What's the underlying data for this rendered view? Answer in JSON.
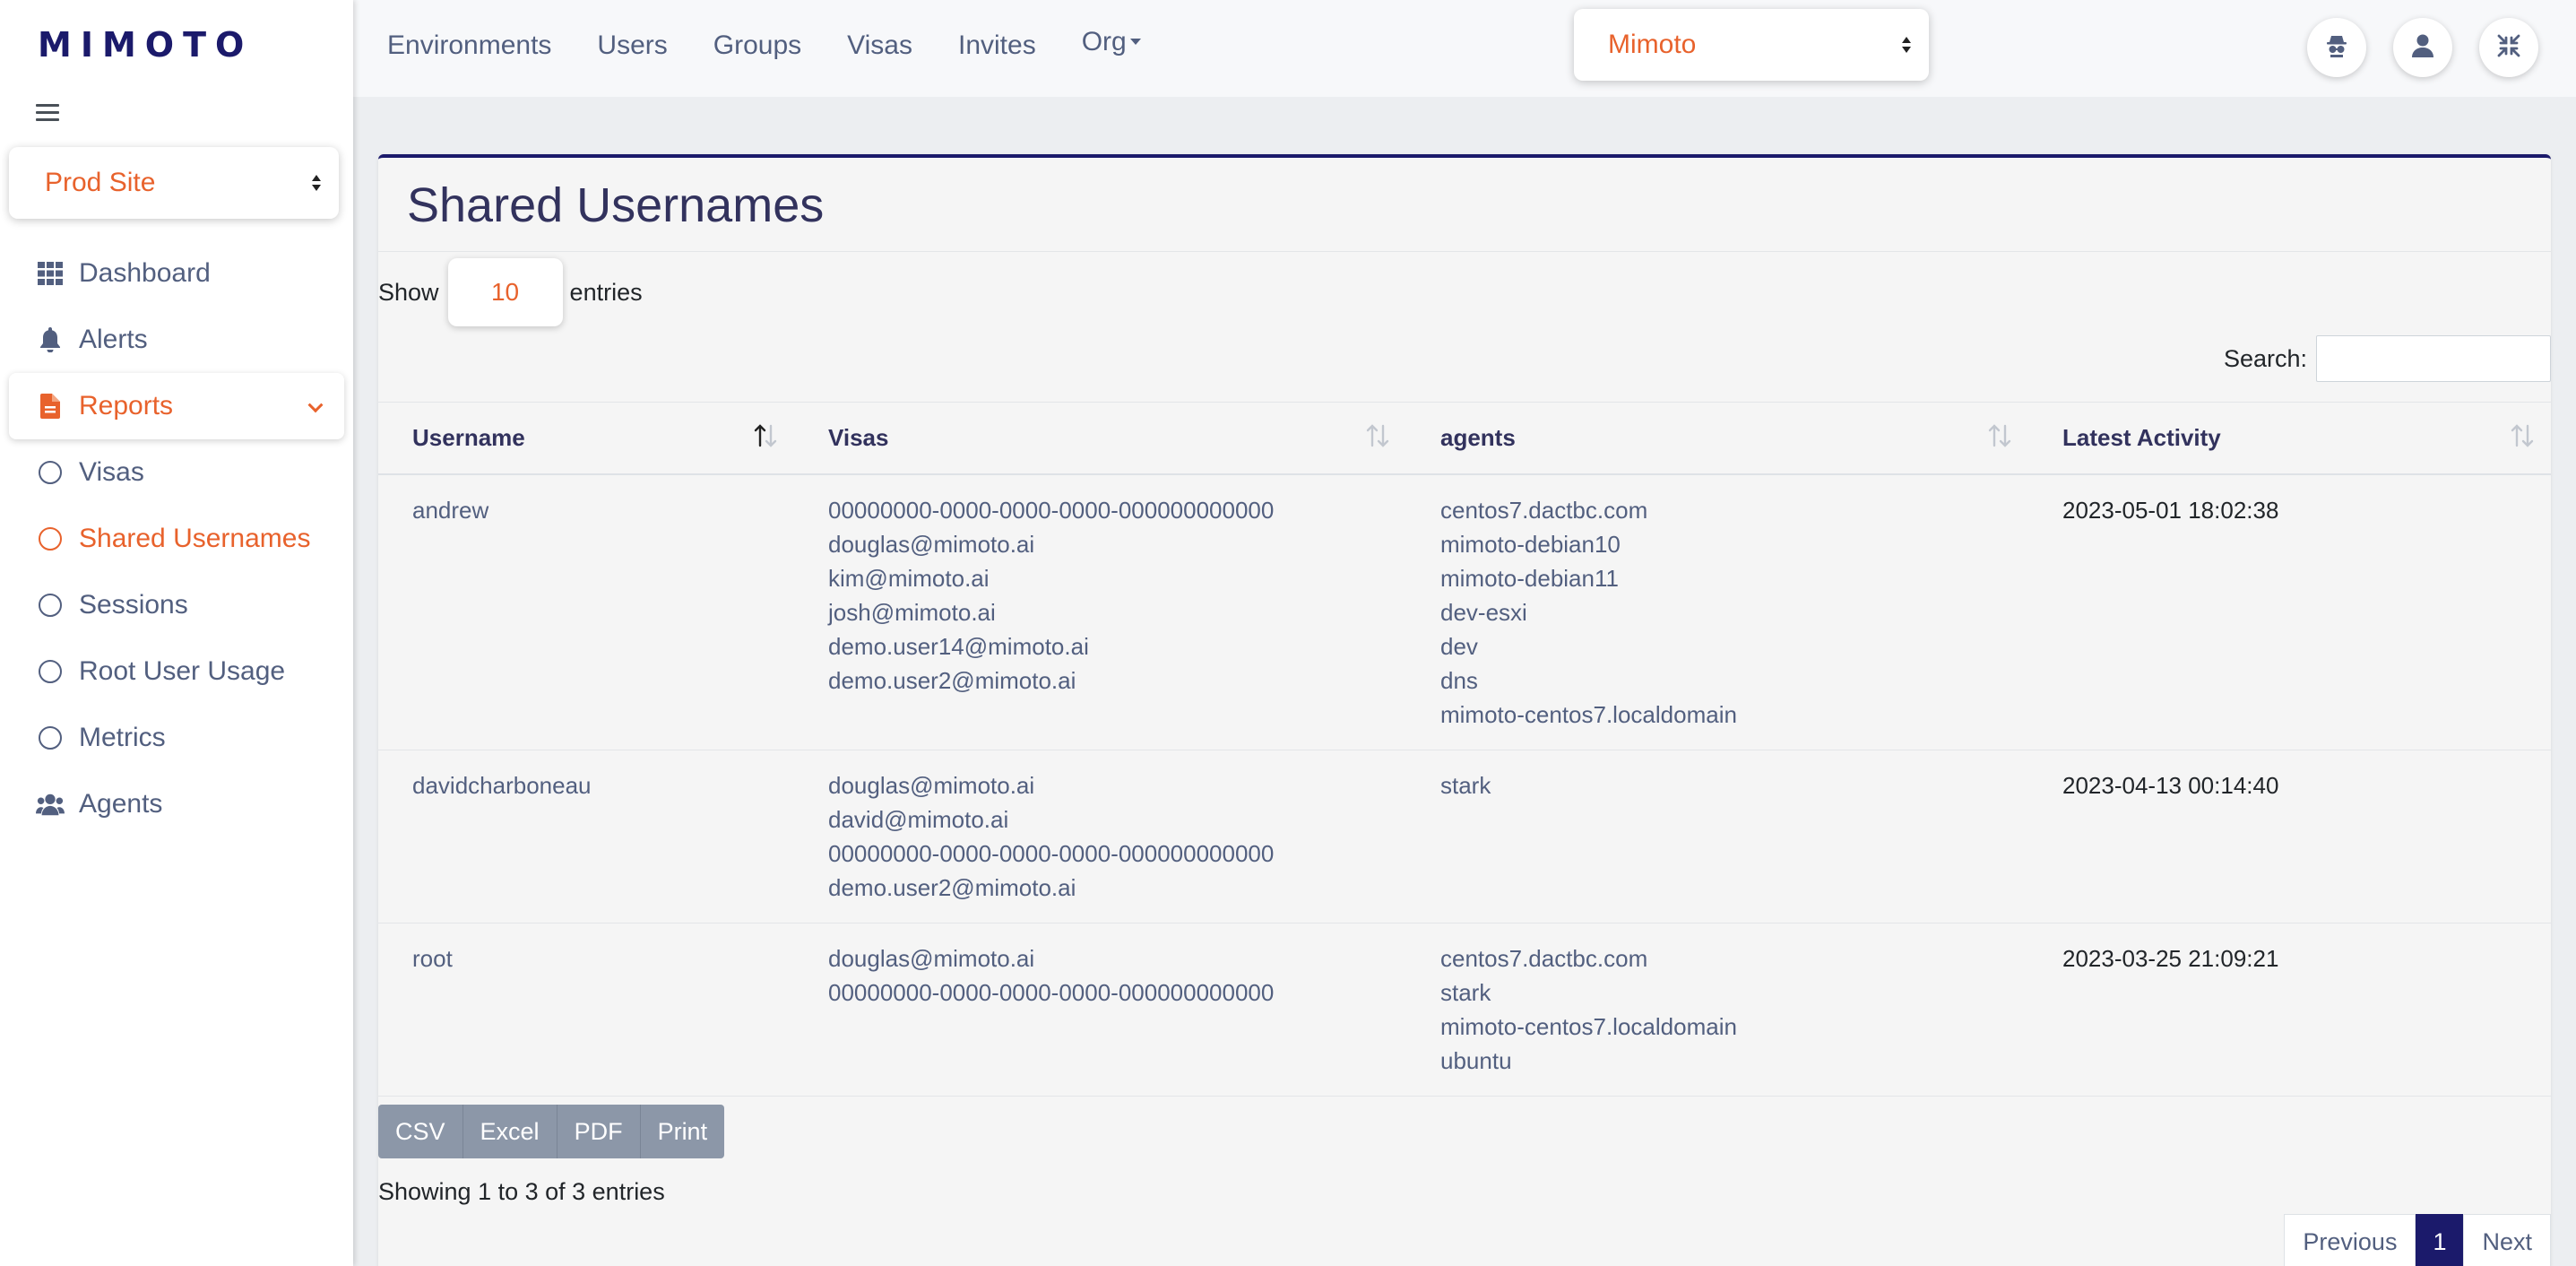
{
  "brand": {
    "logo": "MIMOTO",
    "accent": "#e8622c",
    "primary": "#1b1a6b"
  },
  "sidebar": {
    "site_select": "Prod Site",
    "items": [
      {
        "label": "Dashboard",
        "icon": "grid-icon"
      },
      {
        "label": "Alerts",
        "icon": "bell-icon"
      },
      {
        "label": "Reports",
        "icon": "document-icon",
        "expanded": true
      },
      {
        "label": "Visas",
        "icon": "circle-icon"
      },
      {
        "label": "Shared Usernames",
        "icon": "circle-icon",
        "current": true
      },
      {
        "label": "Sessions",
        "icon": "circle-icon"
      },
      {
        "label": "Root User Usage",
        "icon": "circle-icon"
      },
      {
        "label": "Metrics",
        "icon": "circle-icon"
      },
      {
        "label": "Agents",
        "icon": "users-icon"
      }
    ]
  },
  "topnav": {
    "links": [
      "Environments",
      "Users",
      "Groups",
      "Visas",
      "Invites"
    ],
    "org": "Org",
    "tenant_select": "Mimoto",
    "buttons": [
      "spy-icon",
      "user-icon",
      "compress-icon"
    ]
  },
  "main": {
    "title": "Shared Usernames",
    "show_label": "Show",
    "entries_value": "10",
    "entries_label": "entries",
    "search_label": "Search:",
    "search_value": "",
    "columns": [
      "Username",
      "Visas",
      "agents",
      "Latest Activity"
    ],
    "rows": [
      {
        "username": "andrew",
        "visas": [
          "00000000-0000-0000-0000-000000000000",
          "douglas@mimoto.ai",
          "kim@mimoto.ai",
          "josh@mimoto.ai",
          "demo.user14@mimoto.ai",
          "demo.user2@mimoto.ai"
        ],
        "agents": [
          "centos7.dactbc.com",
          "mimoto-debian10",
          "mimoto-debian11",
          "dev-esxi",
          "dev",
          "dns",
          "mimoto-centos7.localdomain"
        ],
        "latest": "2023-05-01 18:02:38"
      },
      {
        "username": "davidcharboneau",
        "visas": [
          "douglas@mimoto.ai",
          "david@mimoto.ai",
          "00000000-0000-0000-0000-000000000000",
          "demo.user2@mimoto.ai"
        ],
        "agents": [
          "stark"
        ],
        "latest": "2023-04-13 00:14:40"
      },
      {
        "username": "root",
        "visas": [
          "douglas@mimoto.ai",
          "00000000-0000-0000-0000-000000000000"
        ],
        "agents": [
          "centos7.dactbc.com",
          "stark",
          "mimoto-centos7.localdomain",
          "ubuntu"
        ],
        "latest": "2023-03-25 21:09:21"
      }
    ],
    "export_buttons": [
      "CSV",
      "Excel",
      "PDF",
      "Print"
    ],
    "info": "Showing 1 to 3 of 3 entries",
    "pager": {
      "prev": "Previous",
      "page": "1",
      "next": "Next"
    }
  }
}
